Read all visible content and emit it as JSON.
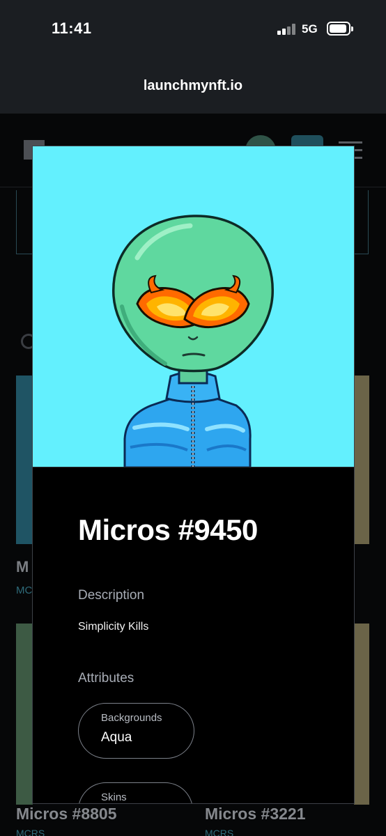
{
  "status_bar": {
    "time": "11:41",
    "network": "5G"
  },
  "browser": {
    "url": "launchmynft.io"
  },
  "background_page": {
    "partial_title": "M",
    "partial_collection": "MC",
    "cards": [
      {
        "name": "Micros #8805",
        "collection": "MCRS"
      },
      {
        "name": "Micros #3221",
        "collection": "MCRS"
      }
    ]
  },
  "modal": {
    "title": "Micros #9450",
    "description_label": "Description",
    "description": "Simplicity Kills",
    "attributes_label": "Attributes",
    "attributes": [
      {
        "trait_type": "Backgrounds",
        "value": "Aqua"
      },
      {
        "trait_type": "Skins",
        "value": ""
      }
    ],
    "image_background_color": "#63f0fe"
  }
}
